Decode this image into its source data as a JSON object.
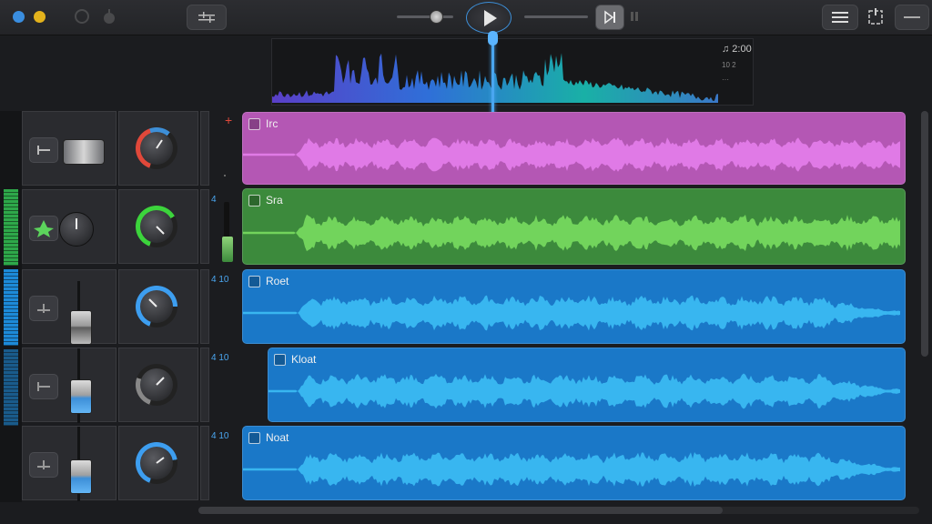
{
  "toolbar": {
    "play_label": "Play",
    "icons": [
      "mixer-icon",
      "list-icon",
      "track-settings-icon",
      "minus-icon"
    ]
  },
  "overview": {
    "time_label": "♫ 2:00",
    "sub_label_1": "10 2",
    "sub_label_2": "···"
  },
  "tracks": [
    {
      "name": "Irc",
      "num": "",
      "color": "#b457b4",
      "wave": "#e07ae6",
      "knob_color": "#e0483a"
    },
    {
      "name": "Sra",
      "num": "4",
      "color": "#3c8a3c",
      "wave": "#72d45c",
      "knob_color": "#3cd43c"
    },
    {
      "name": "Roet",
      "num": "4 10",
      "color": "#1a78c8",
      "wave": "#38b6f0",
      "knob_color": "#3d9ef0"
    },
    {
      "name": "Kloat",
      "num": "4 10",
      "color": "#1a78c8",
      "wave": "#38b6f0",
      "knob_color": "#3d9ef0"
    },
    {
      "name": "Noat",
      "num": "4 10",
      "color": "#1a78c8",
      "wave": "#38b6f0",
      "knob_color": "#3d9ef0"
    }
  ],
  "colors": {
    "accent": "#3d8fd8",
    "background": "#1b1c1f"
  }
}
